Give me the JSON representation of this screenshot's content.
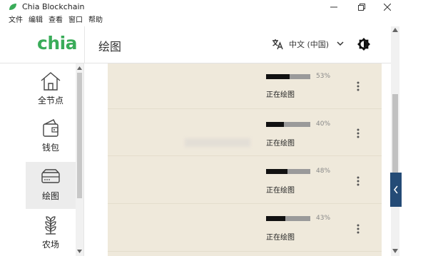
{
  "window": {
    "title": "Chia Blockchain",
    "controls": [
      "minimize",
      "maximize",
      "close"
    ]
  },
  "menu": [
    "文件",
    "编辑",
    "查看",
    "窗口",
    "帮助"
  ],
  "header": {
    "logo": "chia",
    "page_title": "绘图",
    "language": "中文 (中国)"
  },
  "sidebar": {
    "items": [
      {
        "label": "全节点",
        "icon": "home-icon",
        "active": false
      },
      {
        "label": "钱包",
        "icon": "wallet-icon",
        "active": false
      },
      {
        "label": "绘图",
        "icon": "plot-drive-icon",
        "active": true
      },
      {
        "label": "农场",
        "icon": "farm-sprout-icon",
        "active": false
      }
    ]
  },
  "plots": [
    {
      "percent_label": "53%",
      "progress": 0.53,
      "status": "正在绘图"
    },
    {
      "percent_label": "40%",
      "progress": 0.4,
      "status": "正在绘图"
    },
    {
      "percent_label": "48%",
      "progress": 0.48,
      "status": "正在绘图"
    },
    {
      "percent_label": "43%",
      "progress": 0.43,
      "status": "正在绘图"
    }
  ],
  "colors": {
    "brand": "#3aac59",
    "content_bg": "#efe9db",
    "collapse_tab": "#244b76"
  }
}
